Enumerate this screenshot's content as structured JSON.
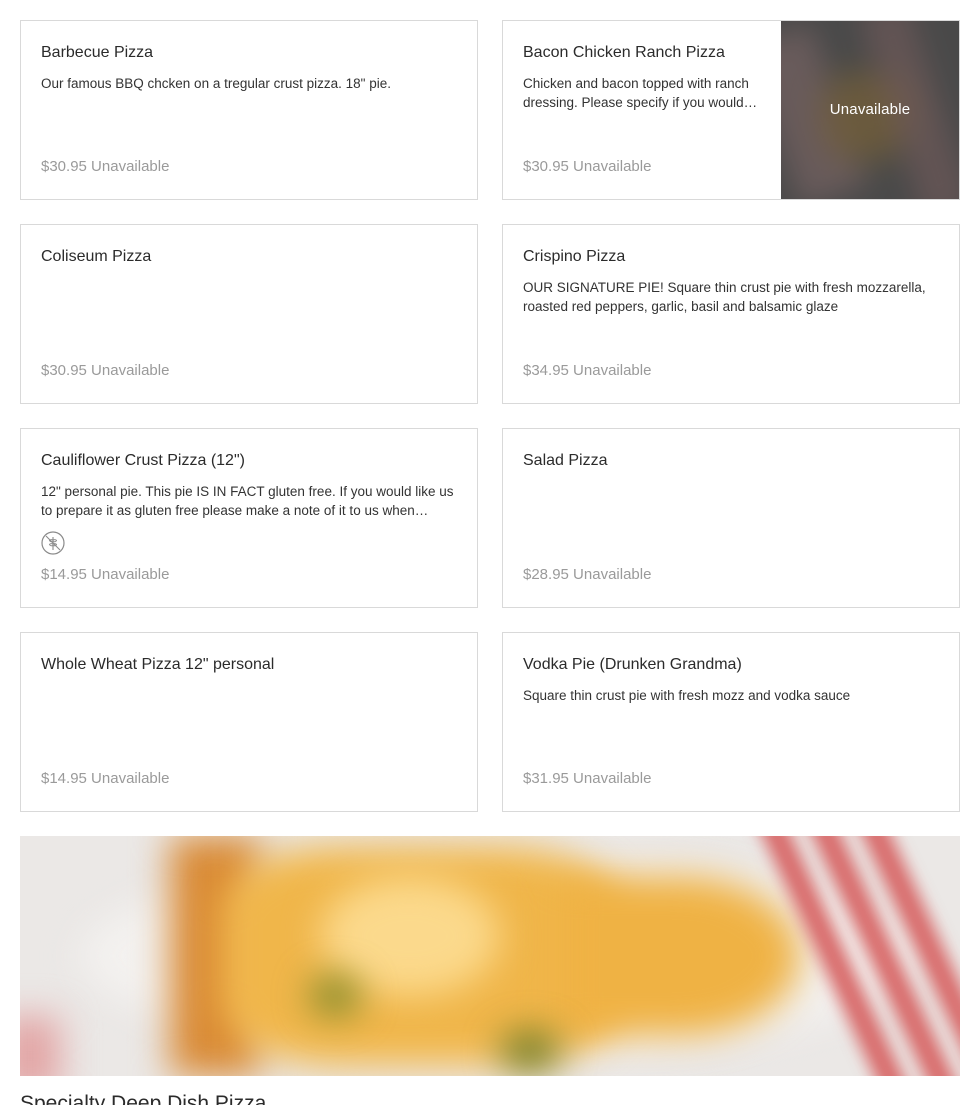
{
  "menu_items": [
    {
      "title": "Barbecue Pizza",
      "description": "Our famous BBQ chcken on a tregular crust pizza. 18\" pie.",
      "price_status": "$30.95 Unavailable"
    },
    {
      "title": "Bacon Chicken Ranch Pizza",
      "description": "Chicken and bacon topped with ranch dressing. Please specify if you would like it",
      "price_status": "$30.95 Unavailable",
      "image_overlay": "Unavailable"
    },
    {
      "title": "Coliseum Pizza",
      "description": "",
      "price_status": "$30.95 Unavailable"
    },
    {
      "title": "Crispino Pizza",
      "description": "OUR SIGNATURE PIE! Square thin crust pie with fresh mozzarella, roasted red peppers, garlic, basil and balsamic glaze",
      "price_status": "$34.95 Unavailable"
    },
    {
      "title": "Cauliflower Crust Pizza (12\")",
      "description": "12\" personal pie. This pie IS IN FACT gluten free. If you would like us to prepare it as gluten free please make a note of it to us when ordering",
      "price_status": "$14.95 Unavailable",
      "dietary_icon": "gluten-free-icon"
    },
    {
      "title": "Salad Pizza",
      "description": "",
      "price_status": "$28.95 Unavailable"
    },
    {
      "title": "Whole Wheat Pizza 12\" personal",
      "description": "",
      "price_status": "$14.95 Unavailable"
    },
    {
      "title": "Vodka Pie (Drunken Grandma)",
      "description": "Square thin crust pie with fresh mozz and vodka sauce",
      "price_status": "$31.95 Unavailable"
    }
  ],
  "next_section": {
    "title": "Specialty Deep Dish Pizza"
  },
  "colors": {
    "price_unavailable": "#9a9a9a",
    "card_border": "#d9d9d9",
    "text": "#2d2d2d"
  }
}
